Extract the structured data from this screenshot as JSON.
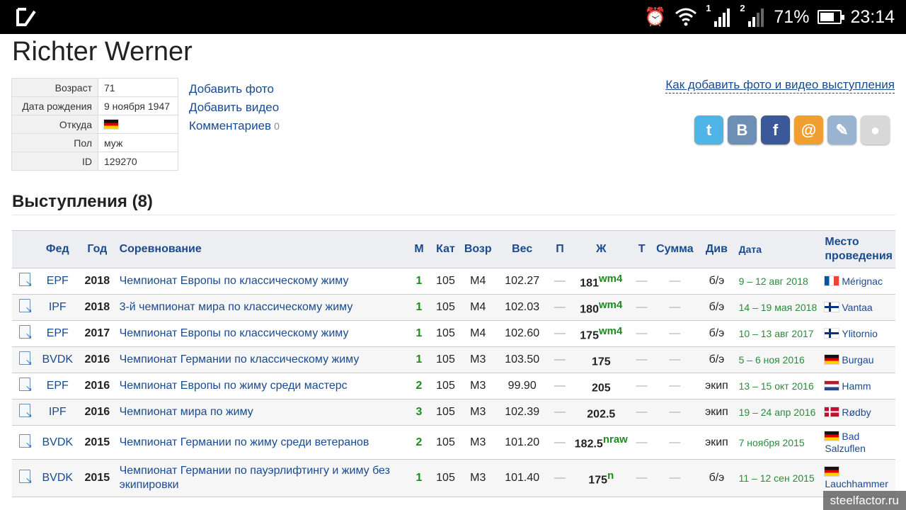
{
  "statusbar": {
    "signal1": "1",
    "signal2": "2",
    "battery_percent": "71%",
    "battery_level": 0.71,
    "time": "23:14"
  },
  "athlete": {
    "name": "Richter Werner",
    "info": [
      {
        "label": "Возраст",
        "value": "71"
      },
      {
        "label": "Дата рождения",
        "value": "9 ноября 1947"
      },
      {
        "label": "Откуда",
        "value": "",
        "flag": "de"
      },
      {
        "label": "Пол",
        "value": "муж"
      },
      {
        "label": "ID",
        "value": "129270"
      }
    ]
  },
  "links": {
    "add_photo": "Добавить фото",
    "add_video": "Добавить видео",
    "comments": "Комментариев",
    "comments_count": "0"
  },
  "howto_link": "Как добавить фото и видео выступления",
  "social": [
    {
      "icon": "twitter-icon",
      "glyph": "t",
      "color": "#4fb4e6"
    },
    {
      "icon": "vkontakte-icon",
      "glyph": "В",
      "color": "#6d8fb4"
    },
    {
      "icon": "facebook-icon",
      "glyph": "f",
      "color": "#3b5998"
    },
    {
      "icon": "mail-icon",
      "glyph": "@",
      "color": "#f0a030"
    },
    {
      "icon": "livejournal-icon",
      "glyph": "✎",
      "color": "#9ab3d0"
    },
    {
      "icon": "google-icon",
      "glyph": "●",
      "color": "#d8d8d8"
    }
  ],
  "section_title": "Выступления (8)",
  "table": {
    "headers": {
      "fed": "Фед",
      "year": "Год",
      "comp": "Соревнование",
      "m": "М",
      "cat": "Кат",
      "age": "Возр",
      "weight": "Вес",
      "p": "П",
      "bp": "Ж",
      "t": "Т",
      "sum": "Сумма",
      "div": "Див",
      "date": "Дата",
      "place": "Место проведения"
    },
    "rows": [
      {
        "fed": "EPF",
        "year": "2018",
        "comp": "Чемпионат Европы по классическому жиму",
        "m": "1",
        "cat": "105",
        "age": "M4",
        "weight": "102.27",
        "p": "—",
        "bp": "181",
        "bp_rec": "wm4",
        "t": "—",
        "sum": "—",
        "div": "б/э",
        "date": "9 – 12 авг 2018",
        "flag": "fr",
        "place": "Mérignac"
      },
      {
        "fed": "IPF",
        "year": "2018",
        "comp": "3-й чемпионат мира по классическому жиму",
        "m": "1",
        "cat": "105",
        "age": "M4",
        "weight": "102.03",
        "p": "—",
        "bp": "180",
        "bp_rec": "wm4",
        "t": "—",
        "sum": "—",
        "div": "б/э",
        "date": "14 – 19 мая 2018",
        "flag": "fi",
        "place": "Vantaa"
      },
      {
        "fed": "EPF",
        "year": "2017",
        "comp": "Чемпионат Европы по классическому жиму",
        "m": "1",
        "cat": "105",
        "age": "M4",
        "weight": "102.60",
        "p": "—",
        "bp": "175",
        "bp_rec": "wm4",
        "t": "—",
        "sum": "—",
        "div": "б/э",
        "date": "10 – 13 авг 2017",
        "flag": "fi",
        "place": "Ylitornio"
      },
      {
        "fed": "BVDK",
        "year": "2016",
        "comp": "Чемпионат Германии по классическому жиму",
        "m": "1",
        "cat": "105",
        "age": "M3",
        "weight": "103.50",
        "p": "—",
        "bp": "175",
        "bp_rec": "",
        "t": "—",
        "sum": "—",
        "div": "б/э",
        "date": "5 – 6 ноя 2016",
        "flag": "de",
        "place": "Burgau"
      },
      {
        "fed": "EPF",
        "year": "2016",
        "comp": "Чемпионат Европы по жиму среди мастерс",
        "m": "2",
        "cat": "105",
        "age": "M3",
        "weight": "99.90",
        "p": "—",
        "bp": "205",
        "bp_rec": "",
        "t": "—",
        "sum": "—",
        "div": "экип",
        "date": "13 – 15 окт 2016",
        "flag": "nl",
        "place": "Hamm"
      },
      {
        "fed": "IPF",
        "year": "2016",
        "comp": "Чемпионат мира по жиму",
        "m": "3",
        "cat": "105",
        "age": "M3",
        "weight": "102.39",
        "p": "—",
        "bp": "202.5",
        "bp_rec": "",
        "t": "—",
        "sum": "—",
        "div": "экип",
        "date": "19 – 24 апр 2016",
        "flag": "dk",
        "place": "Rødby"
      },
      {
        "fed": "BVDK",
        "year": "2015",
        "comp": "Чемпионат Германии по жиму среди ветеранов",
        "m": "2",
        "cat": "105",
        "age": "M3",
        "weight": "101.20",
        "p": "—",
        "bp": "182.5",
        "bp_rec": "nraw",
        "t": "—",
        "sum": "—",
        "div": "экип",
        "date": "7 ноября 2015",
        "flag": "de",
        "place": "Bad Salzuflen"
      },
      {
        "fed": "BVDK",
        "year": "2015",
        "comp": "Чемпионат Германии по пауэрлифтингу и жиму без экипировки",
        "m": "1",
        "cat": "105",
        "age": "M3",
        "weight": "101.40",
        "p": "—",
        "bp": "175",
        "bp_rec": "n",
        "t": "—",
        "sum": "—",
        "div": "б/э",
        "date": "11 – 12 сен 2015",
        "flag": "de",
        "place": "Lauchhammer"
      }
    ]
  },
  "watermark": "steelfactor.ru"
}
